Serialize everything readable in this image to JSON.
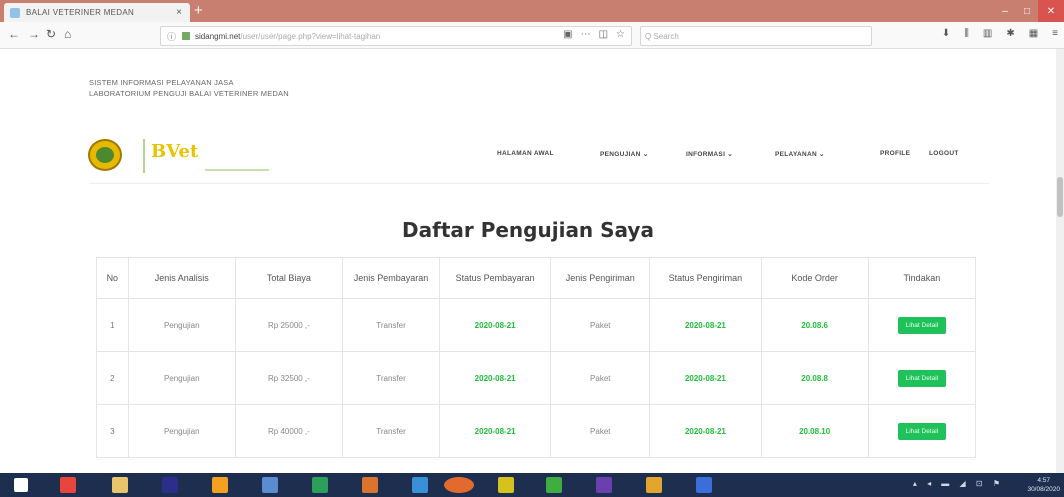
{
  "browser": {
    "tab_title": "BALAI VETERINER MEDAN",
    "tab_close": "×",
    "new_tab": "+",
    "url_host": "sidangmi.net",
    "url_path": "/user/user/page.php?view=lihat-tagihan",
    "search_placeholder": "Q Search",
    "window_min": "–",
    "window_max": "□",
    "window_close": "✕"
  },
  "header": {
    "system_line1": "SISTEM INFORMASI PELAYANAN JASA",
    "system_line2": "LABORATORIUM PENGUJI BALAI VETERINER MEDAN",
    "logo_text": "BVet"
  },
  "menu": {
    "home": "HALAMAN AWAL",
    "testing": "PENGUJIAN ⌄",
    "info": "INFORMASI ⌄",
    "services": "PELAYANAN ⌄",
    "profile": "PROFILE",
    "logout": "LOGOUT"
  },
  "page_title": "Daftar Pengujian Saya",
  "table": {
    "headers": [
      "No",
      "Jenis Analisis",
      "Total Biaya",
      "Jenis Pembayaran",
      "Status Pembayaran",
      "Jenis Pengiriman",
      "Status Pengiriman",
      "Kode Order",
      "Tindakan"
    ],
    "rows": [
      {
        "no": "1",
        "analysis": "Pengujian",
        "cost": "Rp 25000 ,-",
        "payment_type": "Transfer",
        "payment_status": "2020-08-21",
        "shipping_type": "Paket",
        "shipping_status": "2020-08-21",
        "order_code": "20.08.6",
        "action": "Lihat Detail"
      },
      {
        "no": "2",
        "analysis": "Pengujian",
        "cost": "Rp 32500 ,-",
        "payment_type": "Transfer",
        "payment_status": "2020-08-21",
        "shipping_type": "Paket",
        "shipping_status": "2020-08-21",
        "order_code": "20.08.8",
        "action": "Lihat Detail"
      },
      {
        "no": "3",
        "analysis": "Pengujian",
        "cost": "Rp 40000 ,-",
        "payment_type": "Transfer",
        "payment_status": "2020-08-21",
        "shipping_type": "Paket",
        "shipping_status": "2020-08-21",
        "order_code": "20.08.10",
        "action": "Lihat Detail"
      }
    ]
  },
  "taskbar": {
    "clock_time": "4:57",
    "clock_date": "30/08/2020"
  },
  "colors": {
    "accent_green": "#1fc15b",
    "titlebar": "#c97f6f",
    "taskbar": "#1e2e4e"
  }
}
